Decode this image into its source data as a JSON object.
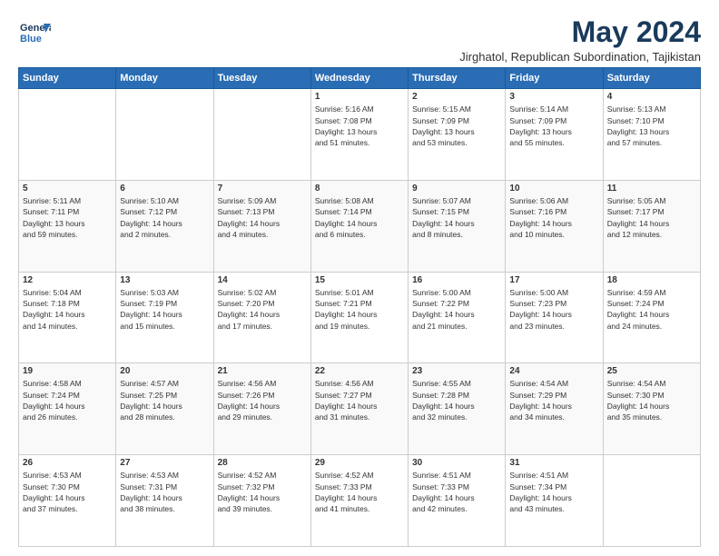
{
  "header": {
    "logo_line1": "General",
    "logo_line2": "Blue",
    "title": "May 2024",
    "subtitle": "Jirghatol, Republican Subordination, Tajikistan"
  },
  "days_of_week": [
    "Sunday",
    "Monday",
    "Tuesday",
    "Wednesday",
    "Thursday",
    "Friday",
    "Saturday"
  ],
  "weeks": [
    [
      {
        "num": "",
        "info": ""
      },
      {
        "num": "",
        "info": ""
      },
      {
        "num": "",
        "info": ""
      },
      {
        "num": "1",
        "info": "Sunrise: 5:16 AM\nSunset: 7:08 PM\nDaylight: 13 hours\nand 51 minutes."
      },
      {
        "num": "2",
        "info": "Sunrise: 5:15 AM\nSunset: 7:09 PM\nDaylight: 13 hours\nand 53 minutes."
      },
      {
        "num": "3",
        "info": "Sunrise: 5:14 AM\nSunset: 7:09 PM\nDaylight: 13 hours\nand 55 minutes."
      },
      {
        "num": "4",
        "info": "Sunrise: 5:13 AM\nSunset: 7:10 PM\nDaylight: 13 hours\nand 57 minutes."
      }
    ],
    [
      {
        "num": "5",
        "info": "Sunrise: 5:11 AM\nSunset: 7:11 PM\nDaylight: 13 hours\nand 59 minutes."
      },
      {
        "num": "6",
        "info": "Sunrise: 5:10 AM\nSunset: 7:12 PM\nDaylight: 14 hours\nand 2 minutes."
      },
      {
        "num": "7",
        "info": "Sunrise: 5:09 AM\nSunset: 7:13 PM\nDaylight: 14 hours\nand 4 minutes."
      },
      {
        "num": "8",
        "info": "Sunrise: 5:08 AM\nSunset: 7:14 PM\nDaylight: 14 hours\nand 6 minutes."
      },
      {
        "num": "9",
        "info": "Sunrise: 5:07 AM\nSunset: 7:15 PM\nDaylight: 14 hours\nand 8 minutes."
      },
      {
        "num": "10",
        "info": "Sunrise: 5:06 AM\nSunset: 7:16 PM\nDaylight: 14 hours\nand 10 minutes."
      },
      {
        "num": "11",
        "info": "Sunrise: 5:05 AM\nSunset: 7:17 PM\nDaylight: 14 hours\nand 12 minutes."
      }
    ],
    [
      {
        "num": "12",
        "info": "Sunrise: 5:04 AM\nSunset: 7:18 PM\nDaylight: 14 hours\nand 14 minutes."
      },
      {
        "num": "13",
        "info": "Sunrise: 5:03 AM\nSunset: 7:19 PM\nDaylight: 14 hours\nand 15 minutes."
      },
      {
        "num": "14",
        "info": "Sunrise: 5:02 AM\nSunset: 7:20 PM\nDaylight: 14 hours\nand 17 minutes."
      },
      {
        "num": "15",
        "info": "Sunrise: 5:01 AM\nSunset: 7:21 PM\nDaylight: 14 hours\nand 19 minutes."
      },
      {
        "num": "16",
        "info": "Sunrise: 5:00 AM\nSunset: 7:22 PM\nDaylight: 14 hours\nand 21 minutes."
      },
      {
        "num": "17",
        "info": "Sunrise: 5:00 AM\nSunset: 7:23 PM\nDaylight: 14 hours\nand 23 minutes."
      },
      {
        "num": "18",
        "info": "Sunrise: 4:59 AM\nSunset: 7:24 PM\nDaylight: 14 hours\nand 24 minutes."
      }
    ],
    [
      {
        "num": "19",
        "info": "Sunrise: 4:58 AM\nSunset: 7:24 PM\nDaylight: 14 hours\nand 26 minutes."
      },
      {
        "num": "20",
        "info": "Sunrise: 4:57 AM\nSunset: 7:25 PM\nDaylight: 14 hours\nand 28 minutes."
      },
      {
        "num": "21",
        "info": "Sunrise: 4:56 AM\nSunset: 7:26 PM\nDaylight: 14 hours\nand 29 minutes."
      },
      {
        "num": "22",
        "info": "Sunrise: 4:56 AM\nSunset: 7:27 PM\nDaylight: 14 hours\nand 31 minutes."
      },
      {
        "num": "23",
        "info": "Sunrise: 4:55 AM\nSunset: 7:28 PM\nDaylight: 14 hours\nand 32 minutes."
      },
      {
        "num": "24",
        "info": "Sunrise: 4:54 AM\nSunset: 7:29 PM\nDaylight: 14 hours\nand 34 minutes."
      },
      {
        "num": "25",
        "info": "Sunrise: 4:54 AM\nSunset: 7:30 PM\nDaylight: 14 hours\nand 35 minutes."
      }
    ],
    [
      {
        "num": "26",
        "info": "Sunrise: 4:53 AM\nSunset: 7:30 PM\nDaylight: 14 hours\nand 37 minutes."
      },
      {
        "num": "27",
        "info": "Sunrise: 4:53 AM\nSunset: 7:31 PM\nDaylight: 14 hours\nand 38 minutes."
      },
      {
        "num": "28",
        "info": "Sunrise: 4:52 AM\nSunset: 7:32 PM\nDaylight: 14 hours\nand 39 minutes."
      },
      {
        "num": "29",
        "info": "Sunrise: 4:52 AM\nSunset: 7:33 PM\nDaylight: 14 hours\nand 41 minutes."
      },
      {
        "num": "30",
        "info": "Sunrise: 4:51 AM\nSunset: 7:33 PM\nDaylight: 14 hours\nand 42 minutes."
      },
      {
        "num": "31",
        "info": "Sunrise: 4:51 AM\nSunset: 7:34 PM\nDaylight: 14 hours\nand 43 minutes."
      },
      {
        "num": "",
        "info": ""
      }
    ]
  ]
}
